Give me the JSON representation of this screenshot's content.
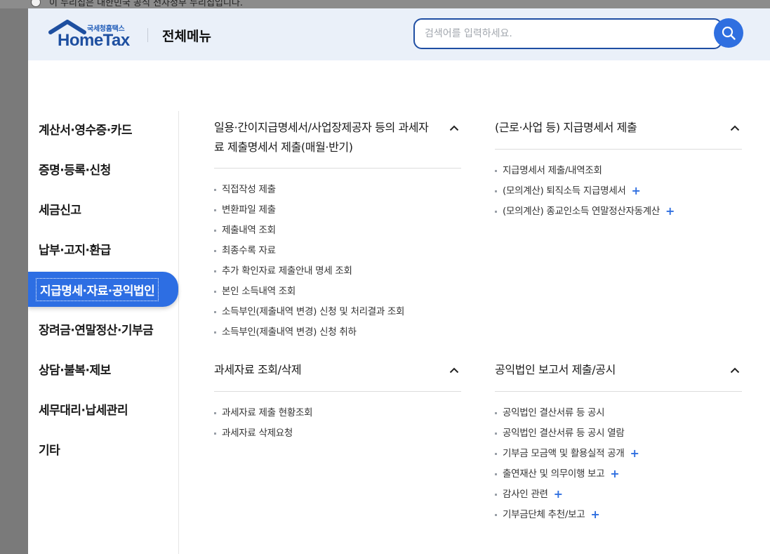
{
  "topbar": {
    "notice": "이 누리집은 대한민국 공식 전자정부 누리집입니다."
  },
  "header": {
    "logo_sub": "국세청홈택스",
    "logo_word": "HomeTax",
    "title": "전체메뉴",
    "search_placeholder": "검색어를 입력하세요."
  },
  "sidebar": {
    "items": [
      {
        "label": "계산서·영수증·카드"
      },
      {
        "label": "증명·등록·신청"
      },
      {
        "label": "세금신고"
      },
      {
        "label": "납부·고지·환급"
      },
      {
        "label": "지급명세·자료·공익법인"
      },
      {
        "label": "장려금·연말정산·기부금"
      },
      {
        "label": "상담·불복·제보"
      },
      {
        "label": "세무대리·납세관리"
      },
      {
        "label": "기타"
      }
    ],
    "active_index": 4
  },
  "sections": [
    {
      "title": "일용·간이지급명세서/사업장제공자 등의 과세자료 제출명세서 제출(매월·반기)",
      "items": [
        {
          "label": "직접작성 제출",
          "expandable": false
        },
        {
          "label": "변환파일 제출",
          "expandable": false
        },
        {
          "label": "제출내역 조회",
          "expandable": false
        },
        {
          "label": "최종수록 자료",
          "expandable": false
        },
        {
          "label": "추가 확인자료 제출안내 명세 조회",
          "expandable": false
        },
        {
          "label": "본인 소득내역 조회",
          "expandable": false
        },
        {
          "label": "소득부인(제출내역 변경) 신청 및 처리결과 조회",
          "expandable": false
        },
        {
          "label": "소득부인(제출내역 변경) 신청 취하",
          "expandable": false
        }
      ]
    },
    {
      "title": "(근로·사업 등) 지급명세서 제출",
      "items": [
        {
          "label": "지급명세서 제출/내역조회",
          "expandable": false
        },
        {
          "label": "(모의계산) 퇴직소득 지급명세서",
          "expandable": true
        },
        {
          "label": "(모의계산) 종교인소득 연말정산자동계산",
          "expandable": true
        }
      ]
    },
    {
      "title": "과세자료 조회/삭제",
      "items": [
        {
          "label": "과세자료 제출 현황조회",
          "expandable": false
        },
        {
          "label": "과세자료 삭제요청",
          "expandable": false
        }
      ]
    },
    {
      "title": "공익법인 보고서 제출/공시",
      "items": [
        {
          "label": "공익법인 결산서류 등 공시",
          "expandable": false
        },
        {
          "label": "공익법인 결산서류 등 공시 열람",
          "expandable": false
        },
        {
          "label": "기부금 모금액 및 활용실적 공개",
          "expandable": true
        },
        {
          "label": "출연재산 및 의무이행 보고",
          "expandable": true
        },
        {
          "label": "감사인 관련",
          "expandable": true
        },
        {
          "label": "기부금단체 추천/보고",
          "expandable": true
        }
      ]
    }
  ],
  "icons": {
    "search": "search-icon",
    "collapse": "chevron-up-icon",
    "expand": "plus-icon"
  },
  "colors": {
    "brand_blue": "#2d6ee3",
    "header_bg": "#eaf0f9",
    "search_border": "#1f4ea3",
    "logo_navy": "#1e4fa0"
  }
}
